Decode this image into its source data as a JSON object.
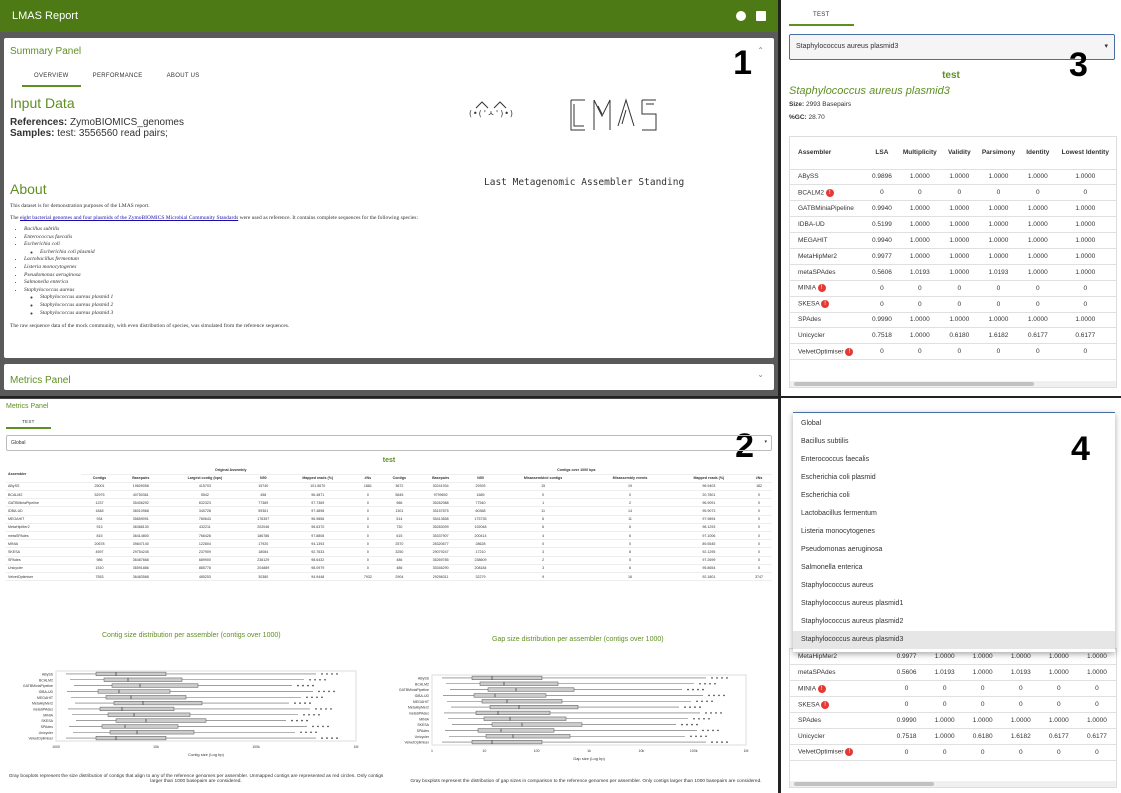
{
  "app": {
    "title": "LMAS Report",
    "github_icon": "github-icon",
    "book_icon": "book-icon",
    "brand_color": "#4d7a14"
  },
  "panel_numbers": [
    "1",
    "2",
    "3",
    "4"
  ],
  "summary": {
    "title": "Summary Panel",
    "tabs": [
      "OVERVIEW",
      "PERFORMANCE",
      "ABOUT US"
    ],
    "input_heading": "Input Data",
    "references_label": "References:",
    "references_value": "ZymoBIOMICS_genomes",
    "samples_label": "Samples:",
    "samples_value": "test: 3556560 read pairs;",
    "logo_caption": "Last Metagenomic Assembler Standing",
    "logo_face": "(•('ㅅ')•)",
    "about_heading": "About",
    "about_line1": "This dataset is for demonstration purposes of the LMAS report.",
    "about_line2_pre": "The ",
    "about_line2_link": "eight bacterial genomes and four plasmids of the ZymoBIOMICS Microbial Community Standards",
    "about_line2_post": " were used as reference. It contains complete sequences for the following species:",
    "species": [
      "Bacillus subtilis",
      "Enterococcus faecalis",
      "Escherichia coli",
      "Lactobacillus fermentum",
      "Listeria monocytogenes",
      "Pseudomonas aeruginosa",
      "Salmonella enterica",
      "Staphylococcus aureus"
    ],
    "ecoli_sub": [
      "Escherichia coli plasmid"
    ],
    "saureus_sub": [
      "Staphylococcus aureus plasmid 1",
      "Staphylococcus aureus plasmid 2",
      "Staphylococcus aureus plasmid 3"
    ],
    "about_line3": "The raw sequence data of the mock community, with even distribution of species, was simulated from the reference sequences.",
    "metrics_collapsed_title": "Metrics Panel"
  },
  "metrics": {
    "title": "Metrics Panel",
    "tab": "TEST",
    "select_value": "Global",
    "sample_title": "test",
    "group1": "Original Assembly",
    "group2": "Contigs over 1000 bps",
    "headers": [
      "Assembler",
      "Contigs",
      "Basepairs",
      "Largest contig (bps)",
      "N50",
      "Mapped reads (%)",
      "#Ns",
      "Contigs",
      "Basepairs",
      "N50",
      "Misassembled contigs",
      "Misassembly events",
      "Mapped reads (%)",
      "#Ns"
    ],
    "rows": [
      [
        "ABySS",
        "25001",
        "19609058",
        "415703",
        "15740",
        "101.5670",
        "1881",
        "3672",
        "30241934",
        "29393",
        "15",
        "19",
        "96.9403",
        "182"
      ],
      [
        "BCALM2",
        "52975",
        "40750361",
        "5542",
        "458",
        "96.4871",
        "0",
        "5845",
        "9799692",
        "1689",
        "0",
        "0",
        "20.7801",
        "0"
      ],
      [
        "GATBMiniaPipeline",
        "1237",
        "35406292",
        "632323",
        "77389",
        "97.7369",
        "0",
        "966",
        "35262988",
        "77540",
        "1",
        "2",
        "96.9091",
        "0"
      ],
      [
        "IDBA-UD",
        "1848",
        "36010968",
        "340728",
        "59361",
        "97.4898",
        "0",
        "1301",
        "35157875",
        "60368",
        "11",
        "14",
        "95.9073",
        "0"
      ],
      [
        "MEGAHIT",
        "934",
        "35659091",
        "780643",
        "176357",
        "96.9856",
        "0",
        "514",
        "35413658",
        "175735",
        "6",
        "11",
        "97.9894",
        "0"
      ],
      [
        "MetaHipMer2",
        "913",
        "36368130",
        "432211",
        "202046",
        "96.6370",
        "0",
        "730",
        "35263099",
        "192048",
        "6",
        "6",
        "98.1293",
        "0"
      ],
      [
        "metaSPAdes",
        "815",
        "36414800",
        "766428",
        "186786",
        "97.8808",
        "0",
        "615",
        "35337907",
        "200414",
        "4",
        "6",
        "97.1006",
        "0"
      ],
      [
        "MINIA",
        "20678",
        "39847140",
        "122804",
        "17920",
        "94.1393",
        "0",
        "2570",
        "28320677",
        "28628",
        "0",
        "0",
        "89.5545",
        "0"
      ],
      [
        "SKESA",
        "4597",
        "29754245",
        "237909",
        "18084",
        "92.7633",
        "0",
        "3250",
        "29079247",
        "17210",
        "3",
        "8",
        "92.1295",
        "0"
      ],
      [
        "SPAdes",
        "986",
        "36487668",
        "689900",
        "236129",
        "98.6432",
        "0",
        "486",
        "35269785",
        "238609",
        "2",
        "5",
        "97.2699",
        "0"
      ],
      [
        "Unicycler",
        "1510",
        "36591886",
        "885778",
        "204889",
        "98.0979",
        "0",
        "486",
        "35346290",
        "208184",
        "3",
        "6",
        "95.8654",
        "0"
      ],
      [
        "VelvetOptimiser",
        "7553",
        "36483568",
        "485253",
        "30380",
        "94.9448",
        "7932",
        "2904",
        "29296311",
        "32279",
        "9",
        "16",
        "92.1801",
        "3747"
      ]
    ],
    "chart1": {
      "title": "Contig size distribution per assembler (contigs over 1000)",
      "xlabel": "Contig size (Log bp)",
      "ticks": [
        "1000",
        "10k",
        "100k",
        "1M"
      ],
      "caption": "Gray boxplots represent the size distribution of contigs that align to any of the reference genomes per assembler. Unmapped contigs are represented as red circles. Only contigs larger than 1000 basepairs are considered."
    },
    "chart2": {
      "title": "Gap size distribution per assembler (contigs over 1000)",
      "xlabel": "Gap size (Log bp)",
      "ticks": [
        "1",
        "10",
        "100",
        "1k",
        "10k",
        "100k",
        "1M"
      ],
      "caption": "Gray boxplots represent the distribution of gap sizes in comparison to the reference genomes per assembler. Only contigs larger than 1000 basepairs are considered."
    }
  },
  "assemblers": [
    "ABySS",
    "BCALM2",
    "GATBMiniaPipeline",
    "IDBA-UD",
    "MEGAHIT",
    "MetaHipMer2",
    "metaSPAdes",
    "MINIA",
    "SKESA",
    "SPAdes",
    "Unicycler",
    "VelvetOptimiser"
  ],
  "detail": {
    "tab": "TEST",
    "select_value": "Staphylococcus aureus plasmid3",
    "sample_title": "test",
    "ref_title": "Staphylococcus aureus plasmid3",
    "size_label": "Size:",
    "size_value": "2993 Basepairs",
    "gc_label": "%GC:",
    "gc_value": "28.70",
    "headers": [
      "Assembler",
      "LSA",
      "Multiplicity",
      "Validity",
      "Parsimony",
      "Identity",
      "Lowest Identity"
    ],
    "rows": [
      [
        "ABySS",
        "0.9896",
        "1.0000",
        "1.0000",
        "1.0000",
        "1.0000",
        "1.0000"
      ],
      [
        "BCALM2",
        "0",
        "0",
        "0",
        "0",
        "0",
        "0"
      ],
      [
        "GATBMiniaPipeline",
        "0.9940",
        "1.0000",
        "1.0000",
        "1.0000",
        "1.0000",
        "1.0000"
      ],
      [
        "IDBA-UD",
        "0.5199",
        "1.0000",
        "1.0000",
        "1.0000",
        "1.0000",
        "1.0000"
      ],
      [
        "MEGAHIT",
        "0.9940",
        "1.0000",
        "1.0000",
        "1.0000",
        "1.0000",
        "1.0000"
      ],
      [
        "MetaHipMer2",
        "0.9977",
        "1.0000",
        "1.0000",
        "1.0000",
        "1.0000",
        "1.0000"
      ],
      [
        "metaSPAdes",
        "0.5606",
        "1.0193",
        "1.0000",
        "1.0193",
        "1.0000",
        "1.0000"
      ],
      [
        "MINIA",
        "0",
        "0",
        "0",
        "0",
        "0",
        "0"
      ],
      [
        "SKESA",
        "0",
        "0",
        "0",
        "0",
        "0",
        "0"
      ],
      [
        "SPAdes",
        "0.9990",
        "1.0000",
        "1.0000",
        "1.0000",
        "1.0000",
        "1.0000"
      ],
      [
        "Unicycler",
        "0.7518",
        "1.0000",
        "0.6180",
        "1.6182",
        "0.6177",
        "0.6177"
      ],
      [
        "VelvetOptimiser",
        "0",
        "0",
        "0",
        "0",
        "0",
        "0"
      ]
    ],
    "flagged": [
      "BCALM2",
      "MINIA",
      "SKESA",
      "VelvetOptimiser"
    ],
    "flag_symbol": "!"
  },
  "dropdown": {
    "options": [
      "Global",
      "Bacillus subtilis",
      "Enterococcus faecalis",
      "Escherichia coli plasmid",
      "Escherichia coli",
      "Lactobacillus fermentum",
      "Listeria monocytogenes",
      "Pseudomonas aeruginosa",
      "Salmonella enterica",
      "Staphylococcus aureus",
      "Staphylococcus aureus plasmid1",
      "Staphylococcus aureus plasmid2",
      "Staphylococcus aureus plasmid3"
    ],
    "selected": "Staphylococcus aureus plasmid3",
    "visible_rows_below": [
      [
        "MetaHipMer2",
        "0.9977",
        "1.0000",
        "1.0000",
        "1.0000",
        "1.0000",
        "1.0000"
      ],
      [
        "metaSPAdes",
        "0.5606",
        "1.0193",
        "1.0000",
        "1.0193",
        "1.0000",
        "1.0000"
      ],
      [
        "MINIA",
        "0",
        "0",
        "0",
        "0",
        "0",
        "0"
      ],
      [
        "SKESA",
        "0",
        "0",
        "0",
        "0",
        "0",
        "0"
      ],
      [
        "SPAdes",
        "0.9990",
        "1.0000",
        "1.0000",
        "1.0000",
        "1.0000",
        "1.0000"
      ],
      [
        "Unicycler",
        "0.7518",
        "1.0000",
        "0.6180",
        "1.6182",
        "0.6177",
        "0.6177"
      ],
      [
        "VelvetOptimiser",
        "0",
        "0",
        "0",
        "0",
        "0",
        "0"
      ]
    ]
  }
}
